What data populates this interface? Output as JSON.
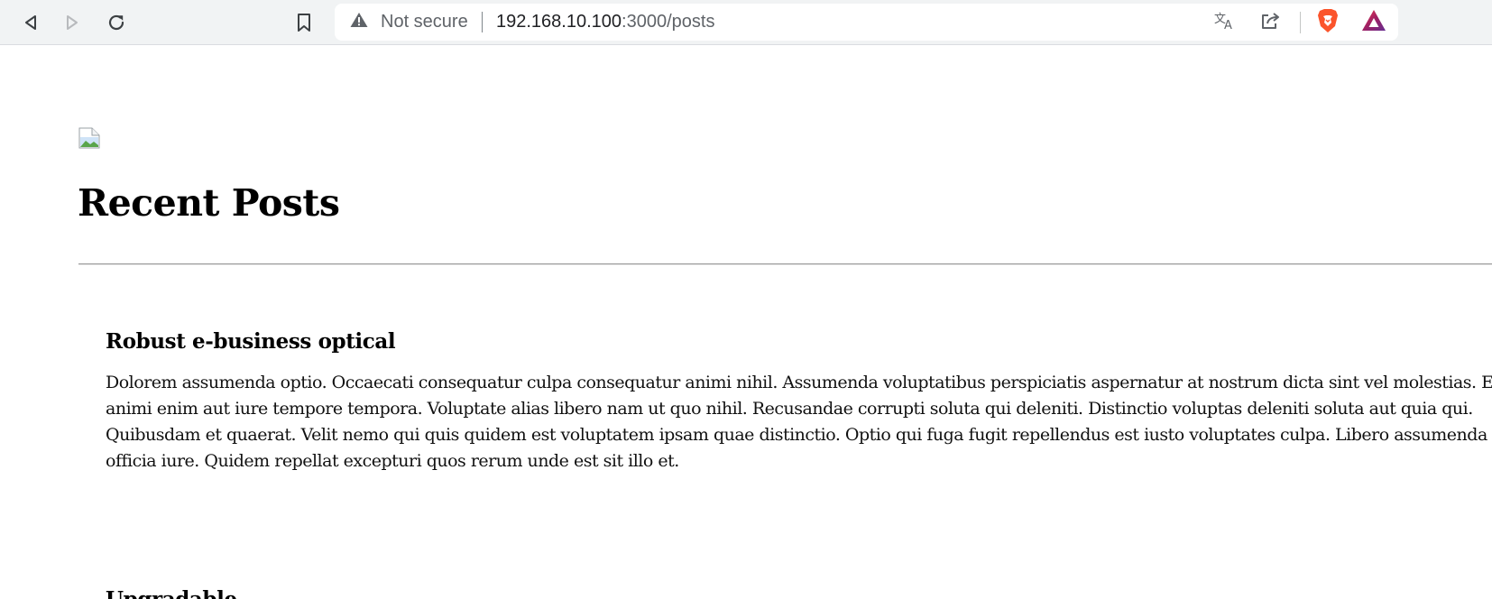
{
  "browser": {
    "security_label": "Not secure",
    "url_host": "192.168.10.100",
    "url_path": ":3000/posts",
    "accent_brave": "#fb542b",
    "accent_rewards": "#662d91",
    "icons": [
      "back-icon",
      "forward-icon",
      "reload-icon",
      "bookmark-icon",
      "warning-icon",
      "translate-icon",
      "share-icon",
      "brave-shields-icon",
      "brave-rewards-icon"
    ]
  },
  "page": {
    "title": "Recent Posts",
    "posts": [
      {
        "title": "Robust e-business optical",
        "body": "Dolorem assumenda optio. Occaecati consequatur culpa consequatur animi nihil. Assumenda voluptatibus perspiciatis aspernatur at nostrum dicta sint vel molestias. Et dolor animi enim aut iure tempore tempora. Voluptate alias libero nam ut quo nihil. Recusandae corrupti soluta qui deleniti. Distinctio voluptas deleniti soluta aut quia qui. Quibusdam et quaerat. Velit nemo qui quis quidem est voluptatem ipsam quae distinctio. Optio qui fuga fugit repellendus est iusto voluptates culpa. Libero assumenda dolor officia iure. Quidem repellat excepturi quos rerum unde est sit illo et."
      },
      {
        "title": "Upgradable"
      }
    ]
  }
}
